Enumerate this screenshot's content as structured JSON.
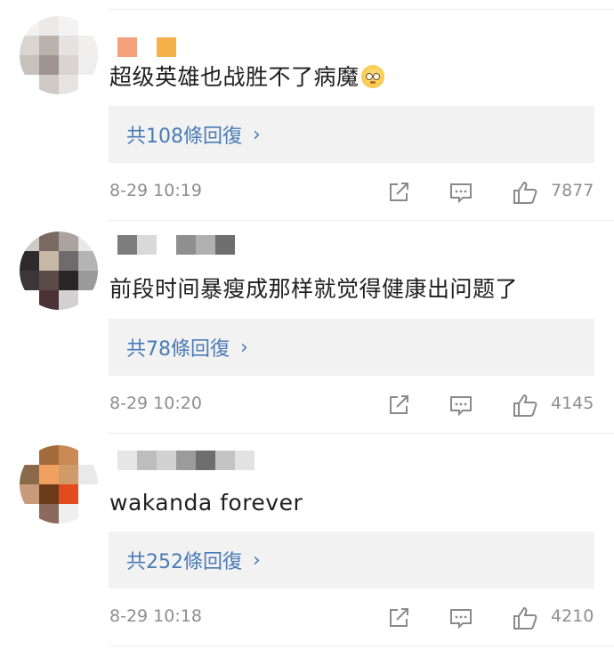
{
  "comments": [
    {
      "text": "超级英雄也战胜不了病魔",
      "emoji": "flushed-face",
      "reply_link": "共108條回復",
      "time": "8-29 10:19",
      "likes": "7877"
    },
    {
      "text": "前段时间暴瘦成那样就觉得健康出问题了",
      "reply_link": "共78條回復",
      "time": "8-29 10:20",
      "likes": "4145"
    },
    {
      "text": "wakanda forever",
      "reply_link": "共252條回復",
      "time": "8-29 10:18",
      "likes": "4210"
    }
  ],
  "icons": {
    "share": "share-icon",
    "reply": "comment-icon",
    "like": "thumbs-up-icon",
    "more": "chevron-right-icon"
  },
  "colors": {
    "link": "#4a7bb7",
    "reply_bg": "#f2f2f2",
    "meta_text": "#8e8e8e",
    "icon": "#8a8a8a"
  }
}
